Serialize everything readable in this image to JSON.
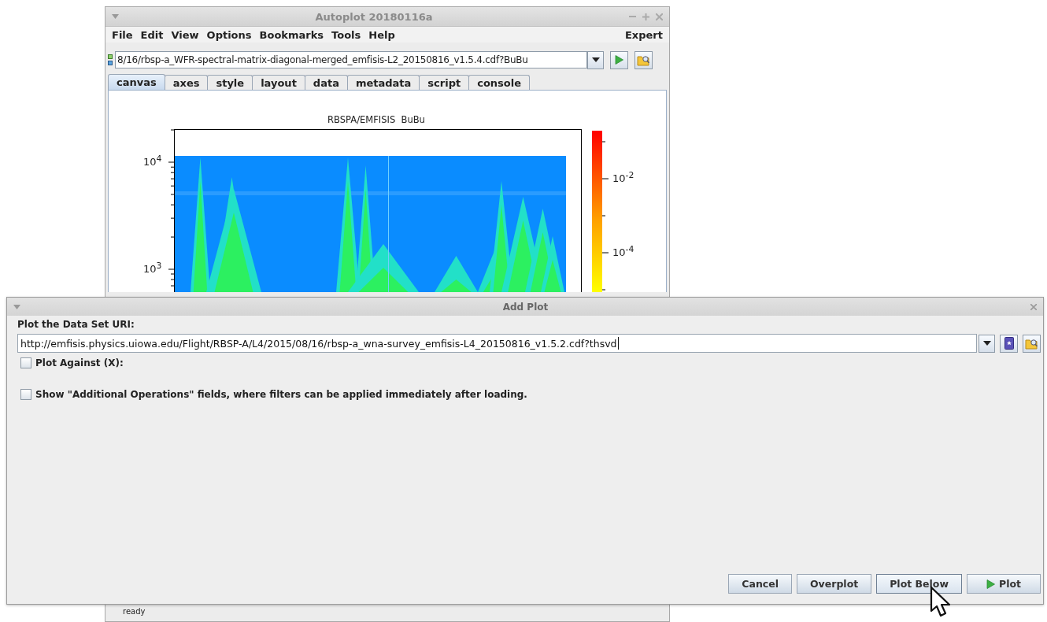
{
  "main_window": {
    "title": "Autoplot 20180116a",
    "menu": [
      "File",
      "Edit",
      "View",
      "Options",
      "Bookmarks",
      "Tools",
      "Help"
    ],
    "menu_right": "Expert",
    "uri": "8/16/rbsp-a_WFR-spectral-matrix-diagonal-merged_emfisis-L2_20150816_v1.5.4.cdf?BuBu",
    "tabs": [
      {
        "label": "canvas",
        "selected": true
      },
      {
        "label": "axes",
        "selected": false
      },
      {
        "label": "style",
        "selected": false
      },
      {
        "label": "layout",
        "selected": false
      },
      {
        "label": "data",
        "selected": false
      },
      {
        "label": "metadata",
        "selected": false
      },
      {
        "label": "script",
        "selected": false
      },
      {
        "label": "console",
        "selected": false
      }
    ],
    "plot": {
      "title": "RBSPA/EMFISIS  BuBu",
      "y_ticks": [
        "10$^{4}$",
        "10$^{3}$"
      ],
      "colorbar_ticks": [
        "10$^{-2}$",
        "10$^{-4}$"
      ]
    },
    "status": "ready"
  },
  "dialog": {
    "title": "Add Plot",
    "uri_label": "Plot the Data Set URI:",
    "uri_value": "http://emfisis.physics.uiowa.edu/Flight/RBSP-A/L4/2015/08/16/rbsp-a_wna-survey_emfisis-L4_20150816_v1.5.2.cdf?thsvd",
    "options": [
      {
        "label": "Plot Against (X):",
        "checked": false
      },
      {
        "label": "Show \"Additional Operations\" fields, where filters can be applied immediately after loading.",
        "checked": false
      }
    ],
    "buttons": [
      {
        "label": "Cancel",
        "kind": "plain",
        "hovered": false
      },
      {
        "label": "Overplot",
        "kind": "plain",
        "hovered": false
      },
      {
        "label": "Plot Below",
        "kind": "plain",
        "hovered": true
      },
      {
        "label": "Plot",
        "kind": "play",
        "hovered": false
      }
    ]
  }
}
